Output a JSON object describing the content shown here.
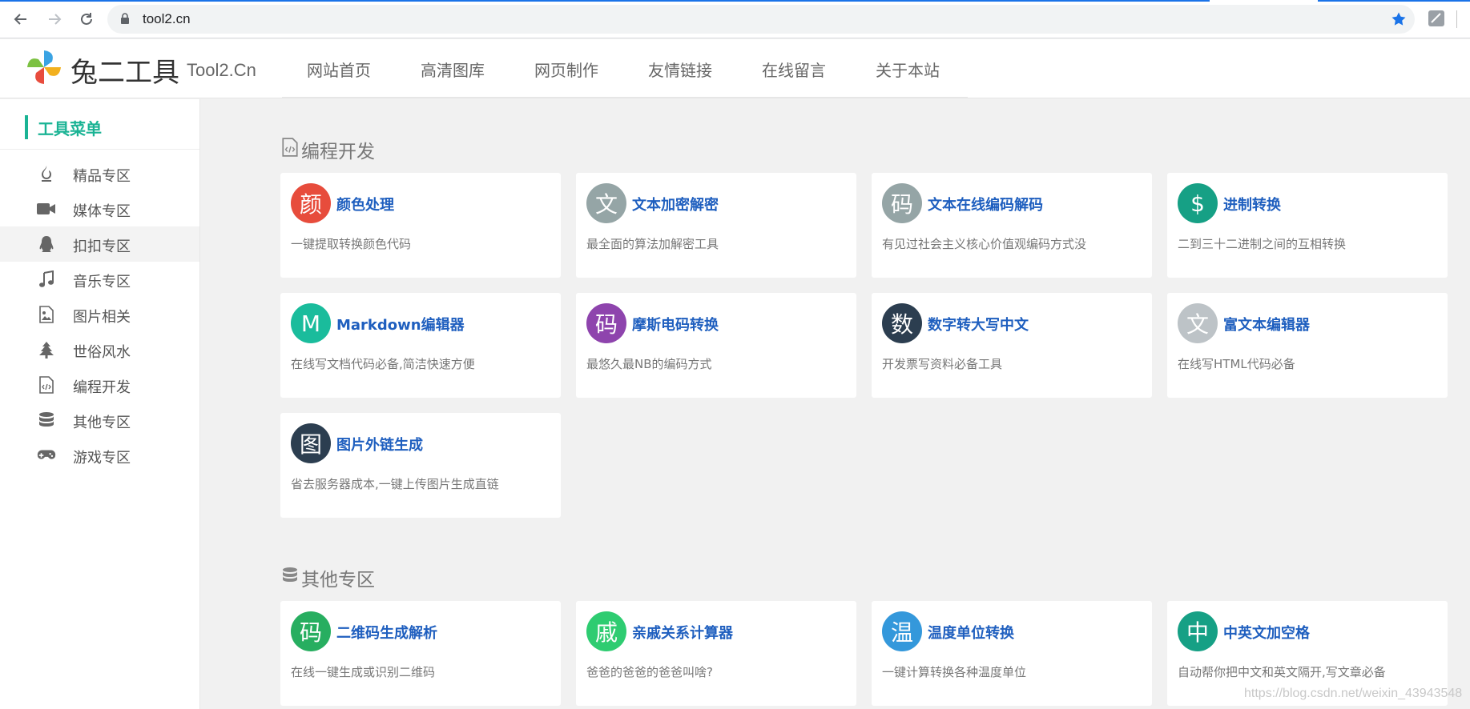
{
  "browser": {
    "url": "tool2.cn"
  },
  "site": {
    "brand": "兔二工具",
    "brand_sub": "Tool2.Cn",
    "nav": [
      "网站首页",
      "高清图库",
      "网页制作",
      "友情链接",
      "在线留言",
      "关于本站"
    ]
  },
  "sidebar": {
    "title": "工具菜单",
    "items": [
      {
        "label": "精品专区",
        "icon": "fire-icon"
      },
      {
        "label": "媒体专区",
        "icon": "video-camera-icon"
      },
      {
        "label": "扣扣专区",
        "icon": "qq-penguin-icon"
      },
      {
        "label": "音乐专区",
        "icon": "music-note-icon"
      },
      {
        "label": "图片相关",
        "icon": "image-file-icon"
      },
      {
        "label": "世俗风水",
        "icon": "tree-icon"
      },
      {
        "label": "编程开发",
        "icon": "code-file-icon"
      },
      {
        "label": "其他专区",
        "icon": "database-icon"
      },
      {
        "label": "游戏专区",
        "icon": "gamepad-icon"
      }
    ],
    "active_index": 2
  },
  "sections": [
    {
      "title": "编程开发",
      "icon": "code-file-icon",
      "cards": [
        {
          "avatar": "颜",
          "color": "#e74c3c",
          "title": "颜色处理",
          "desc": "一键提取转换颜色代码"
        },
        {
          "avatar": "文",
          "color": "#95a5a6",
          "title": "文本加密解密",
          "desc": "最全面的算法加解密工具"
        },
        {
          "avatar": "码",
          "color": "#95a5a6",
          "title": "文本在线编码解码",
          "desc": "有见过社会主义核心价值观编码方式没"
        },
        {
          "avatar": "$",
          "color": "#16a085",
          "title": "进制转换",
          "desc": "二到三十二进制之间的互相转换"
        },
        {
          "avatar": "M",
          "color": "#1abc9c",
          "title": "Markdown编辑器",
          "desc": "在线写文档代码必备,简洁快速方便"
        },
        {
          "avatar": "码",
          "color": "#8e44ad",
          "title": "摩斯电码转换",
          "desc": "最悠久最NB的编码方式"
        },
        {
          "avatar": "数",
          "color": "#2c3e50",
          "title": "数字转大写中文",
          "desc": "开发票写资料必备工具"
        },
        {
          "avatar": "文",
          "color": "#bdc3c7",
          "title": "富文本编辑器",
          "desc": "在线写HTML代码必备"
        },
        {
          "avatar": "图",
          "color": "#2c3e50",
          "title": "图片外链生成",
          "desc": "省去服务器成本,一键上传图片生成直链"
        }
      ]
    },
    {
      "title": "其他专区",
      "icon": "database-icon",
      "cards": [
        {
          "avatar": "码",
          "color": "#27ae60",
          "title": "二维码生成解析",
          "desc": "在线一键生成或识别二维码"
        },
        {
          "avatar": "戚",
          "color": "#2ecc71",
          "title": "亲戚关系计算器",
          "desc": "爸爸的爸爸的爸爸叫啥?"
        },
        {
          "avatar": "温",
          "color": "#3498db",
          "title": "温度单位转换",
          "desc": "一键计算转换各种温度单位"
        },
        {
          "avatar": "中",
          "color": "#16a085",
          "title": "中英文加空格",
          "desc": "自动帮你把中文和英文隔开,写文章必备"
        }
      ]
    }
  ],
  "watermark": "https://blog.csdn.net/weixin_43943548"
}
